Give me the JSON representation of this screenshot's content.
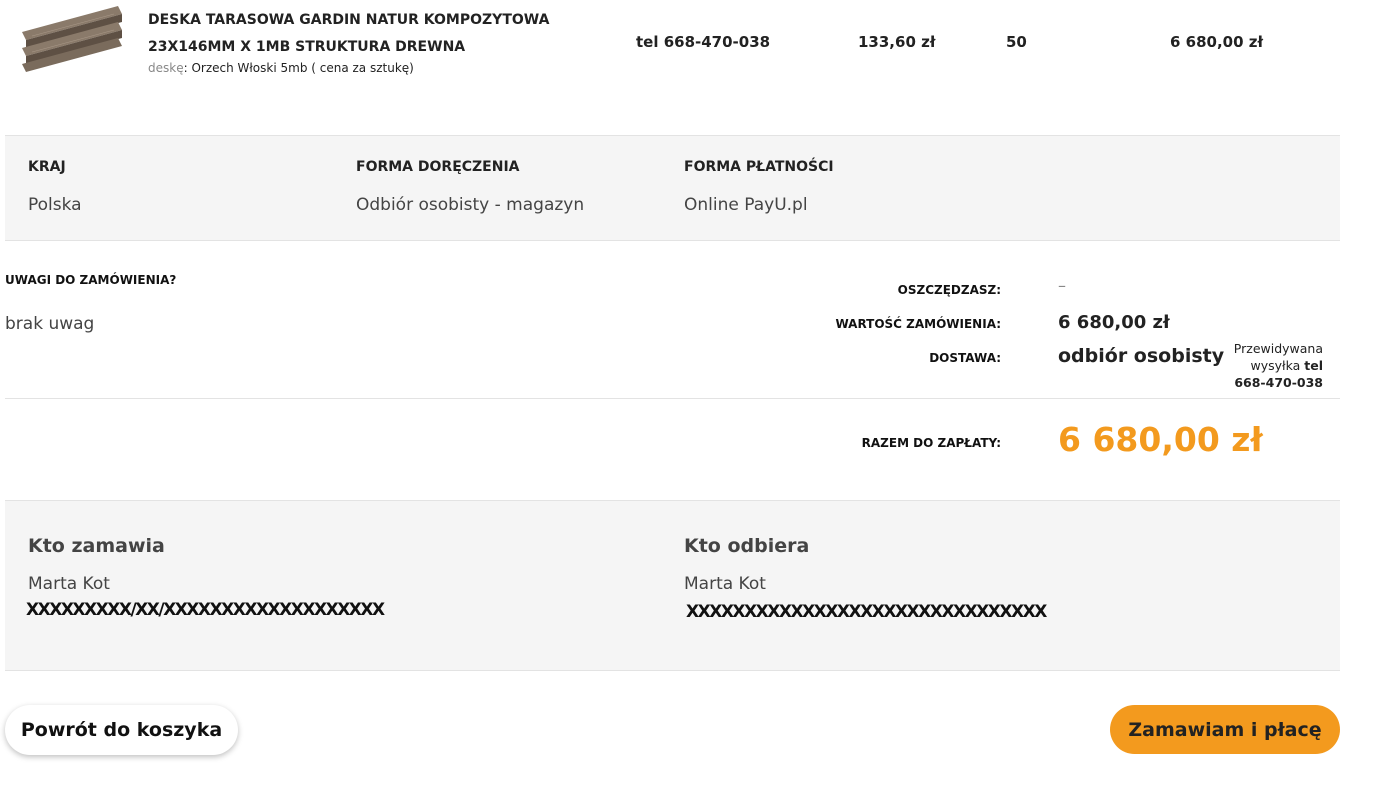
{
  "product": {
    "name": "DESKA TARASOWA GARDIN NATUR KOMPOZYTOWA 23X146MM X 1MB STRUKTURA DREWNA",
    "variant_label": "deskę",
    "variant_value": ": Orzech Włoski 5mb ( cena za sztukę)",
    "availability": "tel 668-470-038",
    "unit_price": "133,60 zł",
    "quantity": "50",
    "total": "6 680,00 zł"
  },
  "info": {
    "country_label": "KRAJ",
    "country_value": "Polska",
    "delivery_label": "FORMA DORĘCZENIA",
    "delivery_value": "Odbiór osobisty - magazyn",
    "payment_label": "FORMA PŁATNOŚCI",
    "payment_value": "Online PayU.pl"
  },
  "notes": {
    "label": "UWAGI DO ZAMÓWIENIA?",
    "value": "brak uwag"
  },
  "summary": {
    "savings_label": "OSZCZĘDZASZ:",
    "savings_value": "–",
    "order_value_label": "WARTOŚĆ ZAMÓWIENIA:",
    "order_value": "6 680,00 zł",
    "shipping_label": "DOSTAWA:",
    "shipping_value": "odbiór osobisty",
    "forecast_text": "Przewidywana wysyłka",
    "forecast_phone": "tel 668-470-038",
    "total_label": "RAZEM DO ZAPŁATY:",
    "total_value": "6 680,00 zł"
  },
  "buyer": {
    "heading": "Kto zamawia",
    "name": "Marta Kot",
    "redacted": "XXXXXXXXX/XX/XXXXXXXXXXXXXXXXXXX"
  },
  "receiver": {
    "heading": "Kto odbiera",
    "name": "Marta Kot",
    "redacted": "XXXXXXXXXXXXXXXXXXXXXXXXXXXXXXX"
  },
  "buttons": {
    "back": "Powrót do koszyka",
    "order": "Zamawiam i płacę"
  },
  "colors": {
    "accent": "#f39a1e",
    "box_bg": "#f5f5f5"
  }
}
